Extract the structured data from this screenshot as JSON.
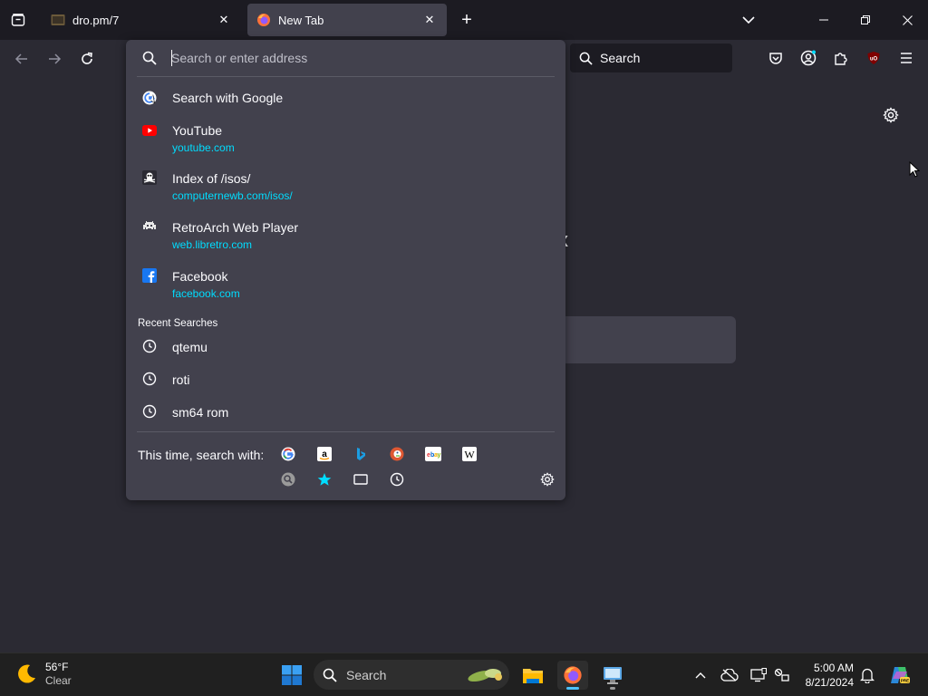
{
  "tabs": [
    {
      "title": "dro.pm/7",
      "active": false
    },
    {
      "title": "New Tab",
      "active": true
    }
  ],
  "navbar": {
    "search_placeholder": "Search"
  },
  "urlbar": {
    "placeholder": "Search or enter address",
    "value": ""
  },
  "suggestions": {
    "search_with": "Search with Google",
    "items": [
      {
        "title": "YouTube",
        "url": "youtube.com",
        "icon": "youtube-icon"
      },
      {
        "title": "Index of /isos/",
        "url": "computernewb.com/isos/",
        "icon": "pirate-icon"
      },
      {
        "title": "RetroArch Web Player",
        "url": "web.libretro.com",
        "icon": "space-invader-icon"
      },
      {
        "title": "Facebook",
        "url": "facebook.com",
        "icon": "facebook-icon"
      }
    ],
    "recent_label": "Recent Searches",
    "recent": [
      "qtemu",
      "roti",
      "sm64 rom"
    ]
  },
  "oneoff": {
    "label": "This time, search with:",
    "engines": [
      "google",
      "amazon",
      "bing",
      "duckduckgo",
      "ebay",
      "wikipedia",
      "extra-search",
      "bookmarks",
      "tabs",
      "history"
    ]
  },
  "taskbar": {
    "weather_temp": "56°F",
    "weather_cond": "Clear",
    "search_placeholder": "Search",
    "time": "5:00 AM",
    "date": "8/21/2024"
  },
  "colors": {
    "accent": "#00ddff",
    "panel": "#42414d",
    "toolbar": "#2b2a33",
    "tabstrip": "#1c1b22"
  }
}
